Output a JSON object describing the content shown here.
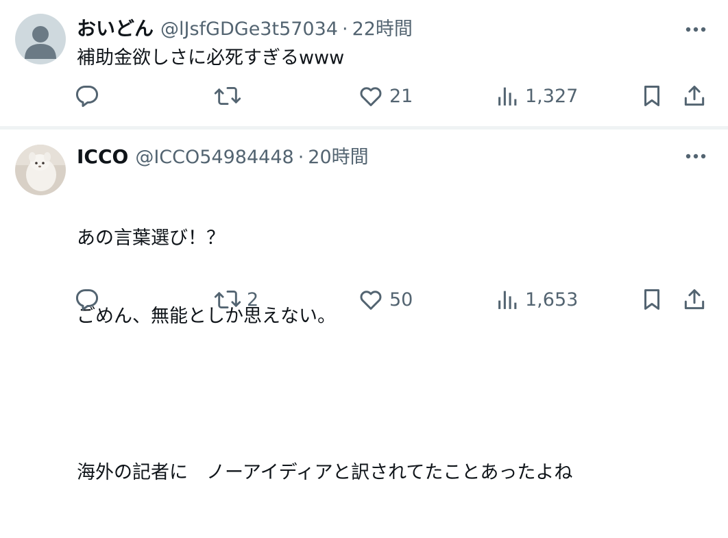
{
  "tweets": [
    {
      "name": "おいどん",
      "handle": "@lJsfGDGe3t57034",
      "separator": "·",
      "time": "22時間",
      "lines": [
        "補助金欲しさに必死すぎるwww"
      ],
      "replies": "",
      "retweets": "",
      "likes": "21",
      "views": "1,327",
      "avatar": "default-person-silhouette"
    },
    {
      "name": "ICCO",
      "handle": "@ICCO54984448",
      "separator": "·",
      "time": "20時間",
      "lines": [
        "あの言葉選び！？",
        "ごめん、無能としか思えない。",
        "",
        "海外の記者に　ノーアイディアと訳されてたことあったよね"
      ],
      "replies": "",
      "retweets": "2",
      "likes": "50",
      "views": "1,653",
      "avatar": "white-plush-photo"
    }
  ],
  "icons": {
    "more": "more-icon",
    "reply": "reply-icon",
    "retweet": "retweet-icon",
    "like": "heart-icon",
    "views": "views-icon",
    "bookmark": "bookmark-icon",
    "share": "share-icon"
  },
  "colors": {
    "text": "#0f1419",
    "muted": "#536471",
    "divider": "#eff3f4",
    "avatar_bg": "#cfd9de",
    "avatar_fg": "#6b7a85"
  }
}
